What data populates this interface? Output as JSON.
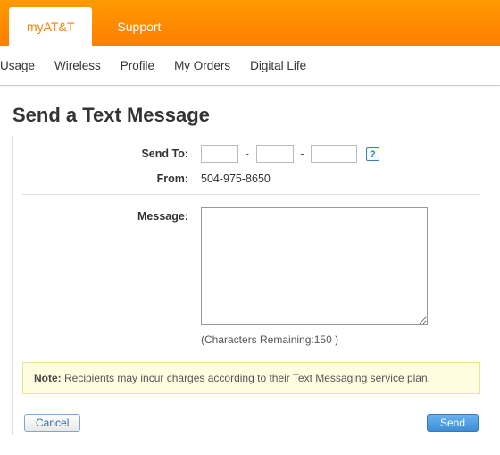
{
  "topnav": {
    "tabs": [
      {
        "label": "myAT&T",
        "active": true
      },
      {
        "label": "Support",
        "active": false
      }
    ]
  },
  "subnav": {
    "items": [
      "Usage",
      "Wireless",
      "Profile",
      "My Orders",
      "Digital Life"
    ]
  },
  "page": {
    "title": "Send a Text Message"
  },
  "form": {
    "sendto_label": "Send To:",
    "sendto_value": [
      "",
      "",
      ""
    ],
    "from_label": "From:",
    "from_value": "504-975-8650",
    "message_label": "Message:",
    "message_value": "",
    "chars_prefix": "(Characters Remaining:",
    "chars_count": "150",
    "chars_suffix": " )"
  },
  "note": {
    "label": "Note:",
    "text": " Recipients may incur charges according to their Text Messaging service plan."
  },
  "actions": {
    "cancel": "Cancel",
    "send": "Send"
  },
  "icons": {
    "help": "?"
  }
}
